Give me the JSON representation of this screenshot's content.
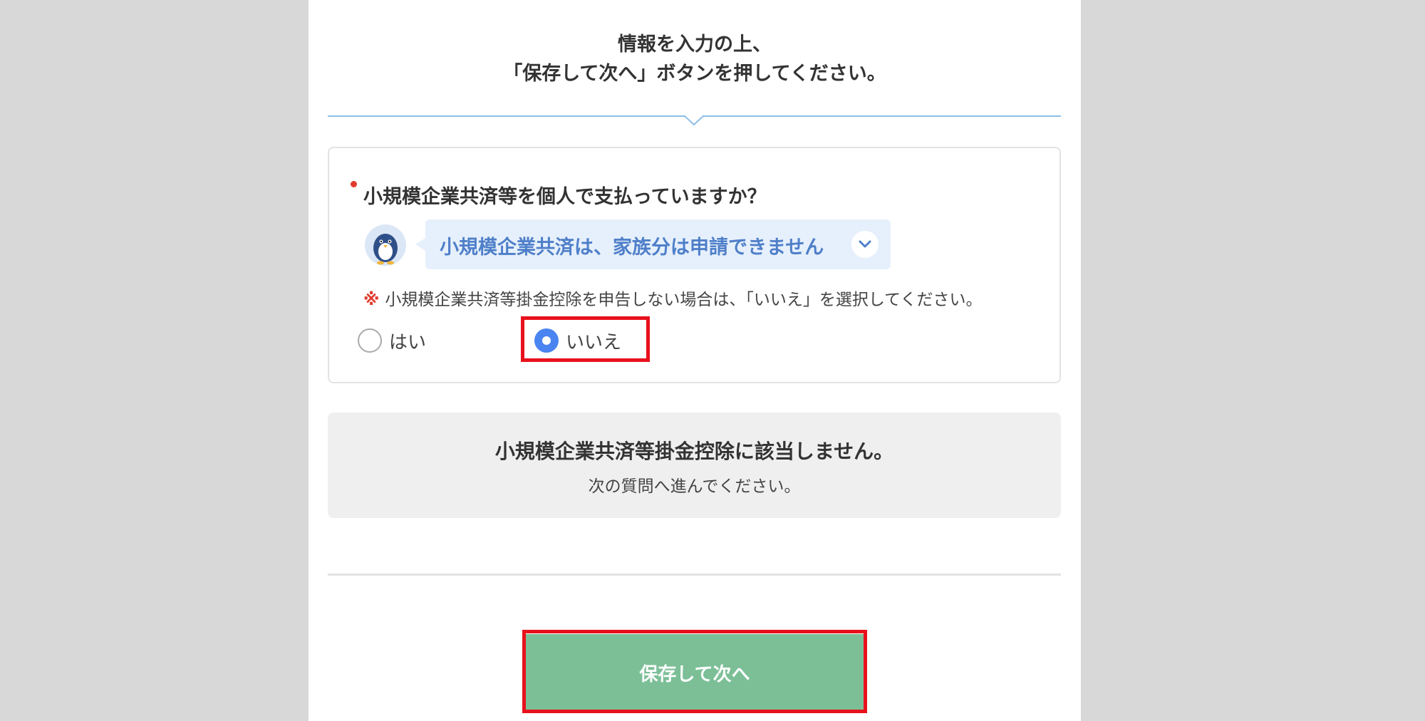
{
  "instruction": {
    "line1": "情報を入力の上、",
    "line2": "「保存して次へ」ボタンを押してください。"
  },
  "question": {
    "label": "小規模企業共済等を個人で支払っていますか？",
    "required": true,
    "hint": {
      "icon": "penguin-mascot-icon",
      "text": "小規模企業共済は、家族分は申請できません",
      "expand_icon": "chevron-down-icon"
    },
    "note_mark": "※",
    "note": "小規模企業共済等掛金控除を申告しない場合は、「いいえ」を選択してください。",
    "options": [
      {
        "label": "はい",
        "checked": false
      },
      {
        "label": "いいえ",
        "checked": true
      }
    ]
  },
  "result": {
    "title": "小規模企業共済等掛金控除に該当しません。",
    "subtitle": "次の質問へ進んでください。"
  },
  "actions": {
    "save_next_label": "保存して次へ"
  },
  "colors": {
    "accent_blue": "#4a84f0",
    "hint_text": "#4f7fc9",
    "hint_bg": "#e6f0fc",
    "button_green": "#7cbf97",
    "highlight_red": "#e8111c",
    "required_red": "#e23a2e"
  }
}
